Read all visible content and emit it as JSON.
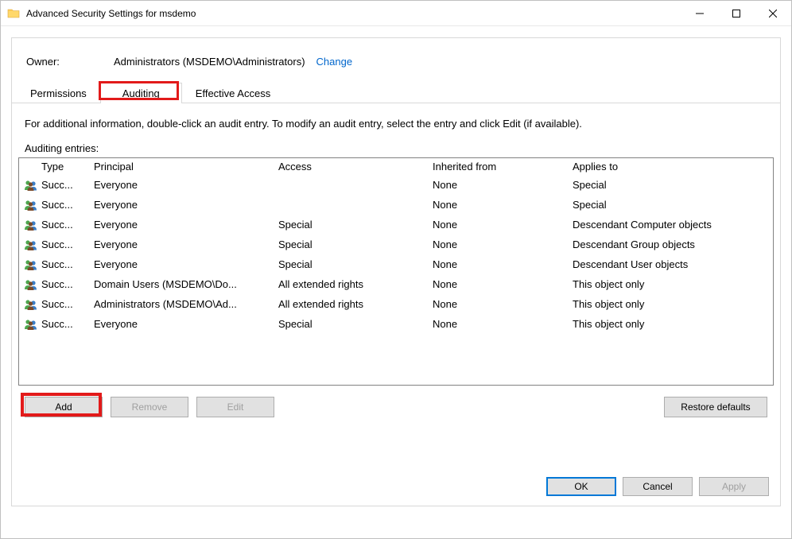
{
  "window": {
    "title": "Advanced Security Settings for msdemo"
  },
  "owner": {
    "label": "Owner:",
    "value": "Administrators (MSDEMO\\Administrators)",
    "change_link": "Change"
  },
  "tabs": {
    "permissions": "Permissions",
    "auditing": "Auditing",
    "effective_access": "Effective Access"
  },
  "body": {
    "info_text": "For additional information, double-click an audit entry. To modify an audit entry, select the entry and click Edit (if available).",
    "entries_label": "Auditing entries:"
  },
  "columns": {
    "type": "Type",
    "principal": "Principal",
    "access": "Access",
    "inherited": "Inherited from",
    "applies": "Applies to"
  },
  "entries": [
    {
      "type": "Succ...",
      "principal": "Everyone",
      "access": "",
      "inherited": "None",
      "applies": "Special"
    },
    {
      "type": "Succ...",
      "principal": "Everyone",
      "access": "",
      "inherited": "None",
      "applies": "Special"
    },
    {
      "type": "Succ...",
      "principal": "Everyone",
      "access": "Special",
      "inherited": "None",
      "applies": "Descendant Computer objects"
    },
    {
      "type": "Succ...",
      "principal": "Everyone",
      "access": "Special",
      "inherited": "None",
      "applies": "Descendant Group objects"
    },
    {
      "type": "Succ...",
      "principal": "Everyone",
      "access": "Special",
      "inherited": "None",
      "applies": "Descendant User objects"
    },
    {
      "type": "Succ...",
      "principal": "Domain Users (MSDEMO\\Do...",
      "access": "All extended rights",
      "inherited": "None",
      "applies": "This object only"
    },
    {
      "type": "Succ...",
      "principal": "Administrators (MSDEMO\\Ad...",
      "access": "All extended rights",
      "inherited": "None",
      "applies": "This object only"
    },
    {
      "type": "Succ...",
      "principal": "Everyone",
      "access": "Special",
      "inherited": "None",
      "applies": "This object only"
    }
  ],
  "buttons": {
    "add": "Add",
    "remove": "Remove",
    "edit": "Edit",
    "restore": "Restore defaults",
    "ok": "OK",
    "cancel": "Cancel",
    "apply": "Apply"
  }
}
